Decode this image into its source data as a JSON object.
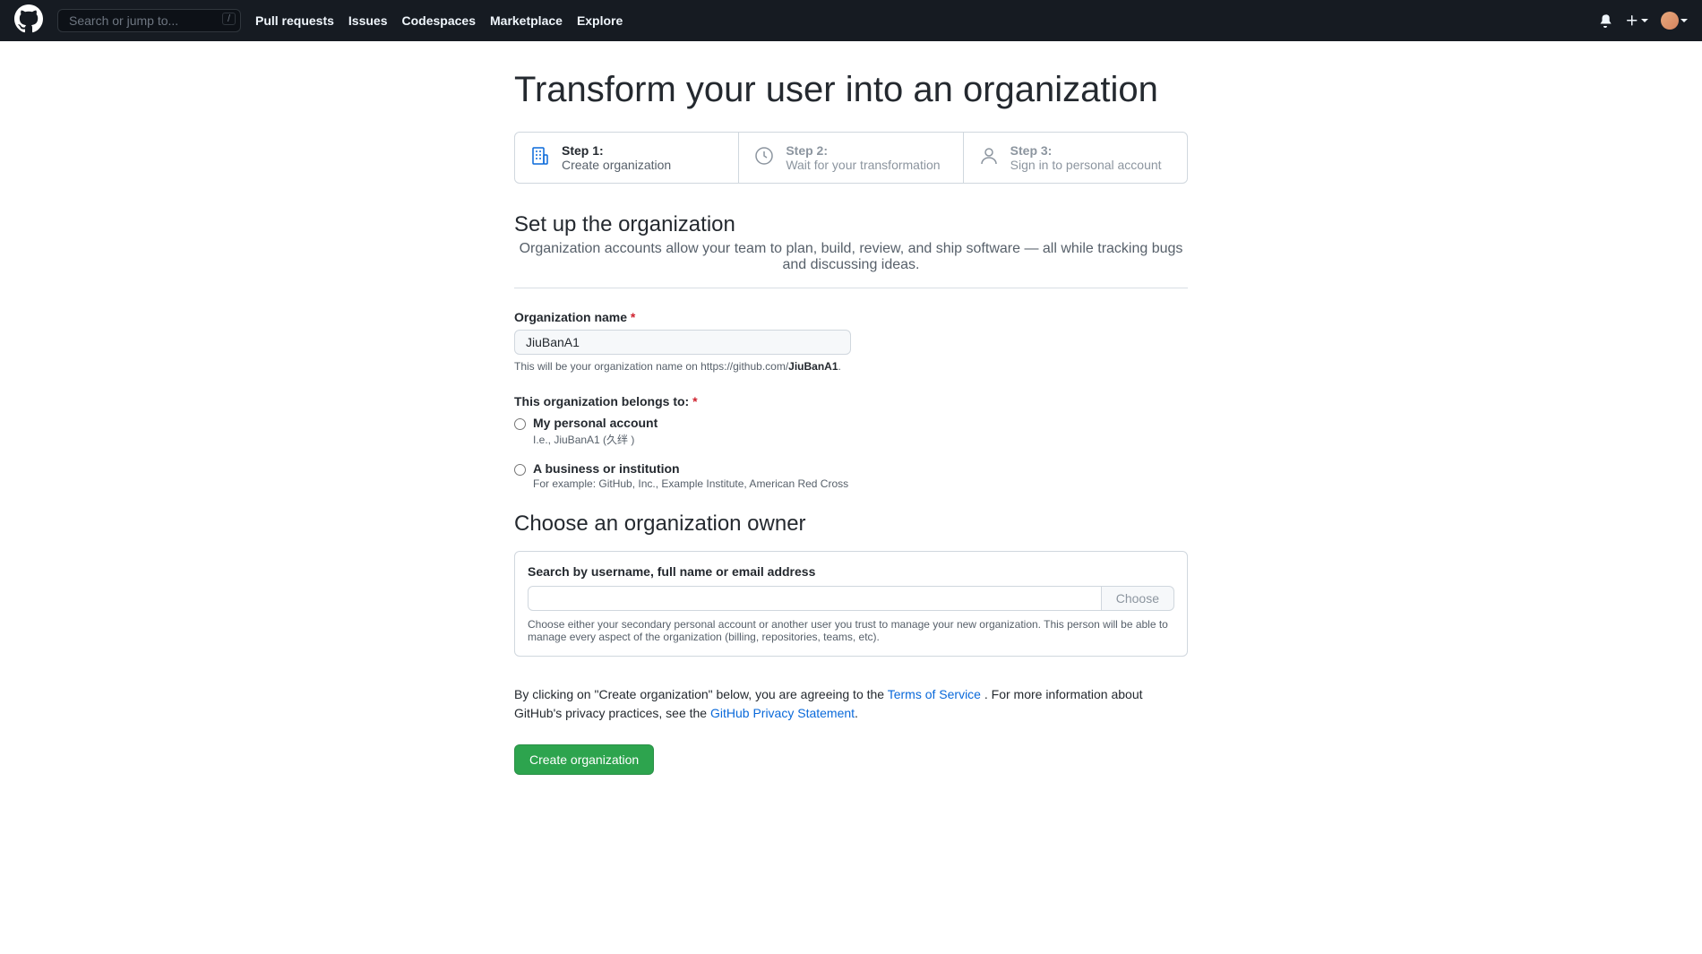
{
  "header": {
    "search_placeholder": "Search or jump to...",
    "slash": "/",
    "nav": [
      "Pull requests",
      "Issues",
      "Codespaces",
      "Marketplace",
      "Explore"
    ]
  },
  "page": {
    "title": "Transform your user into an organization"
  },
  "steps": [
    {
      "label": "Step 1:",
      "desc": "Create organization"
    },
    {
      "label": "Step 2:",
      "desc": "Wait for your transformation"
    },
    {
      "label": "Step 3:",
      "desc": "Sign in to personal account"
    }
  ],
  "setup": {
    "heading": "Set up the organization",
    "desc": "Organization accounts allow your team to plan, build, review, and ship software — all while tracking bugs and discussing ideas.",
    "org_name_label": "Organization name",
    "org_name_value": "JiuBanA1",
    "org_name_note_prefix": "This will be your organization name on https://github.com/",
    "org_name_note_bold": "JiuBanA1",
    "org_name_note_suffix": ".",
    "belongs_label": "This organization belongs to:",
    "radio1_label": "My personal account",
    "radio1_note": "I.e., JiuBanA1 (久绊 )",
    "radio2_label": "A business or institution",
    "radio2_note": "For example: GitHub, Inc., Example Institute, American Red Cross"
  },
  "owner": {
    "heading": "Choose an organization owner",
    "search_label": "Search by username, full name or email address",
    "choose_btn": "Choose",
    "note": "Choose either your secondary personal account or another user you trust to manage your new organization. This person will be able to manage every aspect of the organization (billing, repositories, teams, etc)."
  },
  "terms": {
    "prefix": "By clicking on \"Create organization\" below, you are agreeing to the ",
    "tos": "Terms of Service",
    "middle": " . For more information about GitHub's privacy practices, see the ",
    "privacy": "GitHub Privacy Statement",
    "suffix": "."
  },
  "submit": "Create organization"
}
